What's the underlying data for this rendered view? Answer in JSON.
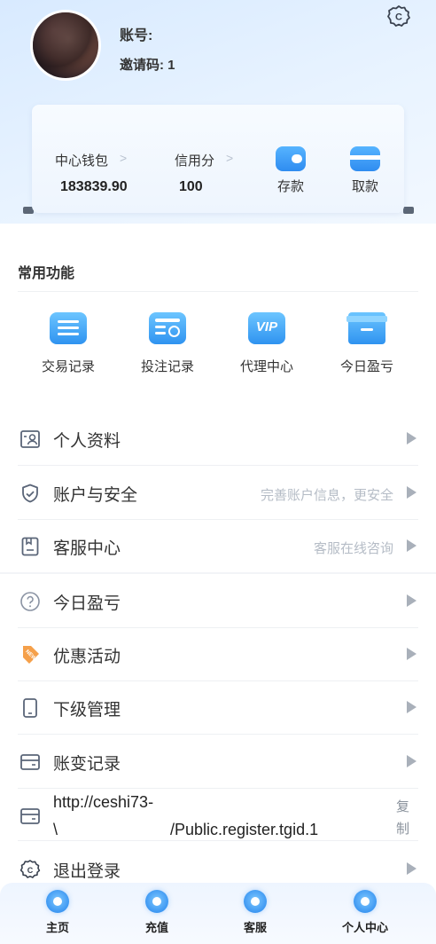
{
  "header": {
    "account_label": "账号:",
    "invite_label": "邀请码: 1"
  },
  "wallet": {
    "center_wallet_label": "中心钱包",
    "center_wallet_value": "183839.90",
    "credit_label": "信用分",
    "credit_value": "100",
    "deposit_label": "存款",
    "withdraw_label": "取款"
  },
  "common": {
    "title": "常用功能",
    "items": [
      {
        "label": "交易记录",
        "icon": "list-icon"
      },
      {
        "label": "投注记录",
        "icon": "bet-record-icon"
      },
      {
        "label": "代理中心",
        "icon": "vip-icon"
      },
      {
        "label": "今日盈亏",
        "icon": "gift-box-icon"
      }
    ]
  },
  "menu": [
    {
      "label": "个人资料",
      "hint": "",
      "icon": "profile-card-icon"
    },
    {
      "label": "账户与安全",
      "hint": "完善账户信息，更安全",
      "icon": "shield-icon"
    },
    {
      "label": "客服中心",
      "hint": "客服在线咨询",
      "icon": "service-icon"
    },
    {
      "label": "今日盈亏",
      "hint": "",
      "icon": "question-icon"
    },
    {
      "label": "优惠活动",
      "hint": "",
      "icon": "new-tag-icon"
    },
    {
      "label": "下级管理",
      "hint": "",
      "icon": "phone-icon"
    },
    {
      "label": "账变记录",
      "hint": "",
      "icon": "card-icon"
    }
  ],
  "link": {
    "line1": "http://ceshi73-",
    "line2_prefix": "\\",
    "line2": "/Public.register.tgid.1",
    "copy1": "复",
    "copy2": "制"
  },
  "logout": {
    "label": "退出登录"
  },
  "tabbar": [
    {
      "label": "主页"
    },
    {
      "label": "充值"
    },
    {
      "label": "客服"
    },
    {
      "label": "个人中心"
    }
  ],
  "colors": {
    "accent": "#2f8cf0",
    "text": "#333333",
    "hint": "#b5bcc6"
  }
}
